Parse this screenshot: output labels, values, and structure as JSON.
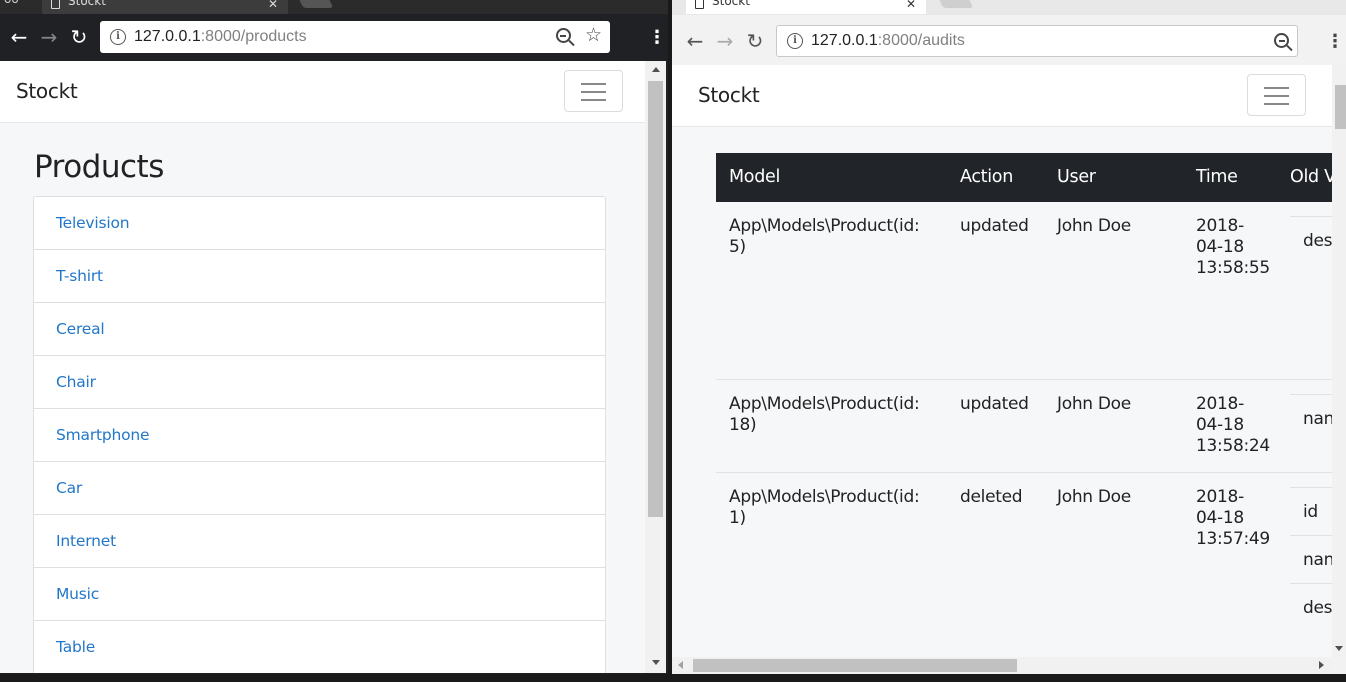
{
  "left_window": {
    "tab": {
      "title": "Stockt",
      "fragment": "oo"
    },
    "url": {
      "host": "127.0.0.1",
      "path": ":8000/products"
    },
    "navbar": {
      "brand": "Stockt"
    },
    "page": {
      "title": "Products",
      "products": [
        "Television",
        "T-shirt",
        "Cereal",
        "Chair",
        "Smartphone",
        "Car",
        "Internet",
        "Music",
        "Table"
      ]
    }
  },
  "right_window": {
    "tab": {
      "title": "Stockt"
    },
    "url": {
      "host": "127.0.0.1",
      "path": ":8000/audits"
    },
    "navbar": {
      "brand": "Stockt"
    },
    "table": {
      "headers": [
        "Model",
        "Action",
        "User",
        "Time",
        "Old V"
      ],
      "rows": [
        {
          "model_line1": "App\\Models\\Product(id:",
          "model_line2": "5)",
          "action": "updated",
          "user": "John Doe",
          "time1": "2018-",
          "time2": "04-18",
          "time3": "13:58:55",
          "old": [
            "des"
          ]
        },
        {
          "model_line1": "App\\Models\\Product(id:",
          "model_line2": "18)",
          "action": "updated",
          "user": "John Doe",
          "time1": "2018-",
          "time2": "04-18",
          "time3": "13:58:24",
          "old": [
            "nan"
          ]
        },
        {
          "model_line1": "App\\Models\\Product(id:",
          "model_line2": "1)",
          "action": "deleted",
          "user": "John Doe",
          "time1": "2018-",
          "time2": "04-18",
          "time3": "13:57:49",
          "old": [
            "id",
            "nan",
            "des"
          ]
        }
      ]
    }
  },
  "colors": {
    "link": "#2277c9",
    "table_header_bg": "#212529",
    "page_bg": "#f5f7f9",
    "dark_chrome": "#202124"
  },
  "icons": [
    "back-arrow-icon",
    "forward-arrow-icon",
    "reload-icon",
    "info-icon",
    "zoom-icon",
    "star-icon",
    "menu-kebab-icon",
    "hamburger-icon",
    "page-icon",
    "close-icon"
  ]
}
